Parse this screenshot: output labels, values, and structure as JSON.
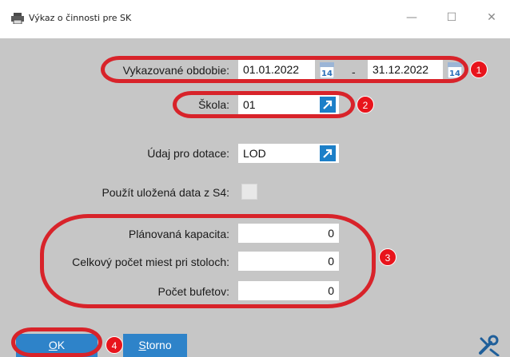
{
  "window": {
    "title": "Výkaz o činnosti pre SK",
    "icons": {
      "app": "printer-icon",
      "minimize": "minimize-icon",
      "maximize": "maximize-icon",
      "close": "close-icon"
    },
    "controls": {
      "minimize": "—",
      "maximize": "☐",
      "close": "✕"
    }
  },
  "form": {
    "period": {
      "label": "Vykazované obdobie:",
      "from": "01.01.2022",
      "separator": "-",
      "to": "31.12.2022",
      "calendar_icon_text": "14"
    },
    "school": {
      "label": "Škola:",
      "value": "01"
    },
    "subsidy": {
      "label": "Údaj pro dotace:",
      "value": "LOD"
    },
    "use_saved": {
      "label": "Použít uložená data z S4:",
      "checked": false
    },
    "planned_capacity": {
      "label": "Plánovaná kapacita:",
      "value": "0"
    },
    "total_seats": {
      "label": "Celkový počet miest pri stoloch:",
      "value": "0"
    },
    "buffets": {
      "label": "Počet bufetov:",
      "value": "0"
    }
  },
  "buttons": {
    "ok": {
      "mnemonic": "O",
      "rest": "K"
    },
    "cancel": {
      "mnemonic": "S",
      "rest": "torno"
    }
  },
  "annotations": {
    "color": "#d8232a",
    "badges": [
      "1",
      "2",
      "3",
      "4"
    ]
  },
  "colors": {
    "dialog_background": "#c6c6c6",
    "button": "#2e83c9",
    "lookup_button": "#1c7fc8",
    "badge": "#e8141c"
  }
}
